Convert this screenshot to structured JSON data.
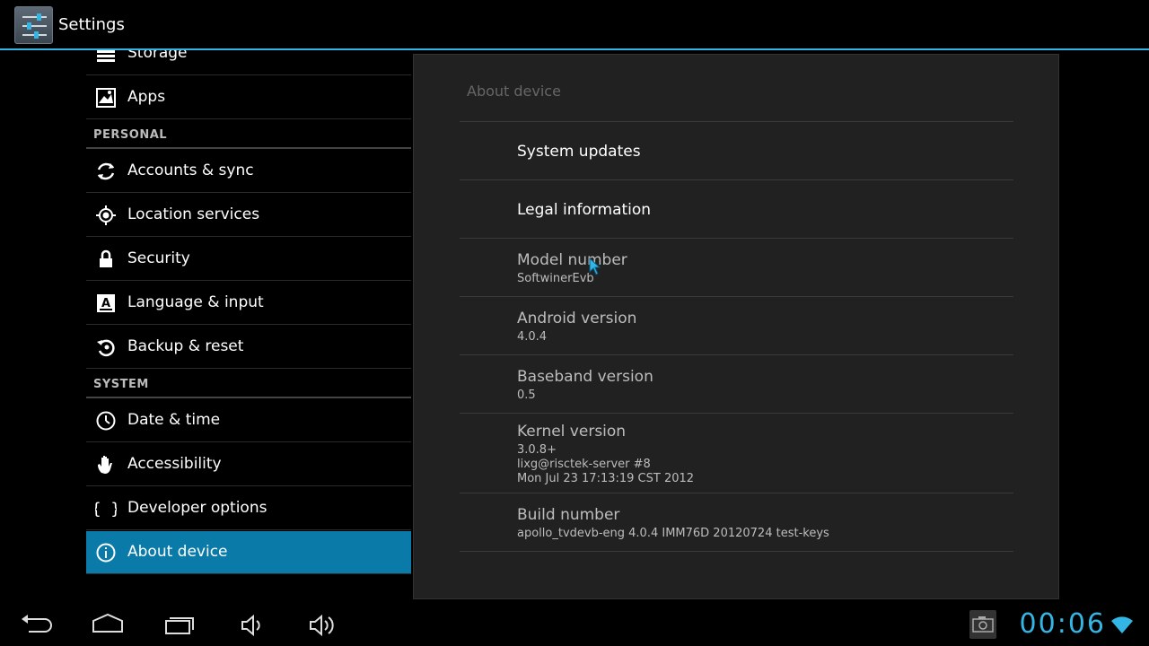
{
  "actionbar": {
    "title": "Settings",
    "app_icon": "settings-sliders-icon"
  },
  "sidebar": {
    "items": [
      {
        "label": "Storage",
        "icon": "storage-icon"
      },
      {
        "label": "Apps",
        "icon": "apps-icon"
      },
      {
        "header": "PERSONAL"
      },
      {
        "label": "Accounts & sync",
        "icon": "sync-icon"
      },
      {
        "label": "Location services",
        "icon": "location-icon"
      },
      {
        "label": "Security",
        "icon": "lock-icon"
      },
      {
        "label": "Language & input",
        "icon": "language-icon"
      },
      {
        "label": "Backup & reset",
        "icon": "backup-icon"
      },
      {
        "header": "SYSTEM"
      },
      {
        "label": "Date & time",
        "icon": "clock-icon"
      },
      {
        "label": "Accessibility",
        "icon": "hand-icon"
      },
      {
        "label": "Developer options",
        "icon": "braces-icon"
      },
      {
        "label": "About device",
        "icon": "info-icon",
        "selected": true
      }
    ]
  },
  "about": {
    "title": "About device",
    "system_updates": "System updates",
    "legal": "Legal information",
    "model_label": "Model number",
    "model_value": "SoftwinerEvb",
    "android_label": "Android version",
    "android_value": "4.0.4",
    "baseband_label": "Baseband version",
    "baseband_value": "0.5",
    "kernel_label": "Kernel version",
    "kernel_line1": "3.0.8+",
    "kernel_line2": "lixg@risctek-server #8",
    "kernel_line3": "Mon Jul 23 17:13:19 CST 2012",
    "build_label": "Build number",
    "build_value": "apollo_tvdevb-eng 4.0.4 IMM76D 20120724 test-keys"
  },
  "statusbar": {
    "clock": "00:06"
  },
  "colors": {
    "accent": "#33b5e5",
    "selected": "#0a7aa8",
    "pane": "#212121"
  }
}
